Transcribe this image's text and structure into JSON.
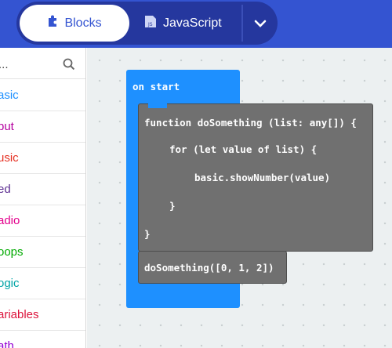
{
  "header": {
    "tab_blocks": "Blocks",
    "tab_javascript": "JavaScript",
    "icons": [
      "puzzle-icon",
      "js-file-icon",
      "chevron-down-icon"
    ]
  },
  "toolbox": {
    "search_placeholder": "...",
    "categories": [
      {
        "label": "asic",
        "color": "#1e90ff"
      },
      {
        "label": "put",
        "color": "#b4009e"
      },
      {
        "label": "usic",
        "color": "#e63022"
      },
      {
        "label": "ed",
        "color": "#5c2d91"
      },
      {
        "label": "adio",
        "color": "#e3008c"
      },
      {
        "label": "oops",
        "color": "#00aa00"
      },
      {
        "label": "ogic",
        "color": "#00a4a6"
      },
      {
        "label": "ariables",
        "color": "#dc143c"
      },
      {
        "label": "ath",
        "color": "#9400d3"
      }
    ]
  },
  "workspace": {
    "on_start": "on start",
    "function_lines": [
      "function doSomething (list: any[]) {",
      "for (let value of list) {",
      "basic.showNumber(value)",
      "}",
      "}"
    ],
    "call": "doSomething([0, 1, 2])"
  }
}
